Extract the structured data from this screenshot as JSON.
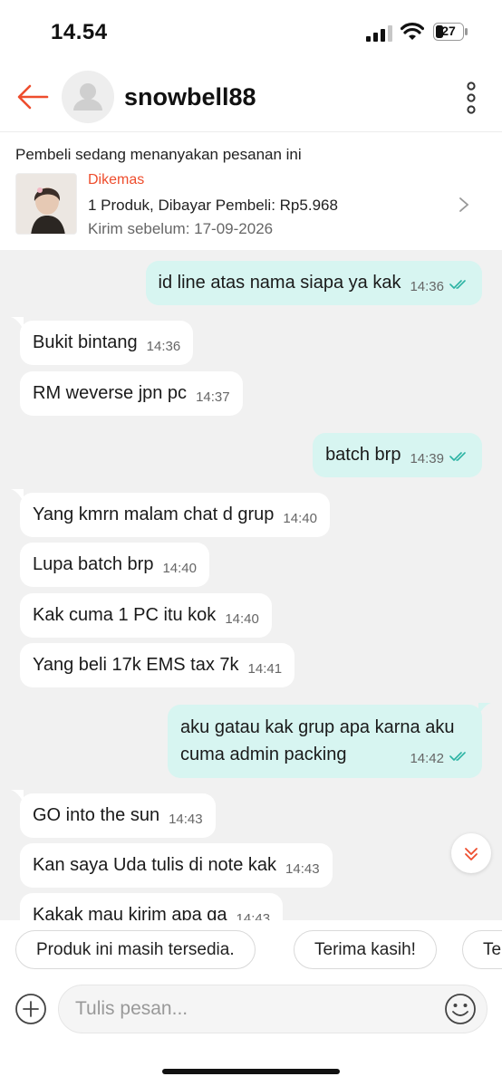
{
  "status_bar": {
    "time": "14.54",
    "battery": "27"
  },
  "header": {
    "username": "snowbell88",
    "icons": {
      "back": "back-arrow-icon",
      "avatar": "user-avatar-icon",
      "more": "more-vertical-icon"
    },
    "accent": "#ee4d2d"
  },
  "order": {
    "notice": "Pembeli sedang menanyakan pesanan ini",
    "status": "Dikemas",
    "summary": "1 Produk, Dibayar Pembeli: Rp5.968",
    "deadline": "Kirim sebelum: 17-09-2026"
  },
  "messages": [
    {
      "dir": "out",
      "text": "id line atas nama siapa ya kak",
      "time": "14:36",
      "read": true
    },
    {
      "dir": "in",
      "text": "Bukit bintang",
      "time": "14:36"
    },
    {
      "dir": "in",
      "text": "RM weverse jpn pc",
      "time": "14:37"
    },
    {
      "dir": "out",
      "text": "batch brp",
      "time": "14:39",
      "read": true
    },
    {
      "dir": "in",
      "text": "Yang kmrn malam chat d grup",
      "time": "14:40"
    },
    {
      "dir": "in",
      "text": "Lupa batch brp",
      "time": "14:40"
    },
    {
      "dir": "in",
      "text": "Kak cuma 1 PC itu kok",
      "time": "14:40"
    },
    {
      "dir": "in",
      "text": "Yang beli 17k EMS tax 7k",
      "time": "14:41"
    },
    {
      "dir": "out",
      "text_line1": "aku gatau kak grup apa karna aku",
      "text_line2": "cuma admin packing",
      "time": "14:42",
      "read": true
    },
    {
      "dir": "in",
      "text": "GO into the sun",
      "time": "14:43"
    },
    {
      "dir": "in",
      "text": "Kan saya Uda tulis di note kak",
      "time": "14:43"
    },
    {
      "dir": "in",
      "text": "Kakak mau kirim apa ga",
      "time": "14:43"
    }
  ],
  "quick_replies": [
    "Produk ini masih tersedia.",
    "Terima kasih!",
    "Te"
  ],
  "input": {
    "placeholder": "Tulis pesan..."
  },
  "colors": {
    "outgoing_bubble": "#d7f5f1",
    "incoming_bubble": "#ffffff",
    "chat_bg": "#f1f1f1",
    "read_tick": "#2bb3a3"
  }
}
